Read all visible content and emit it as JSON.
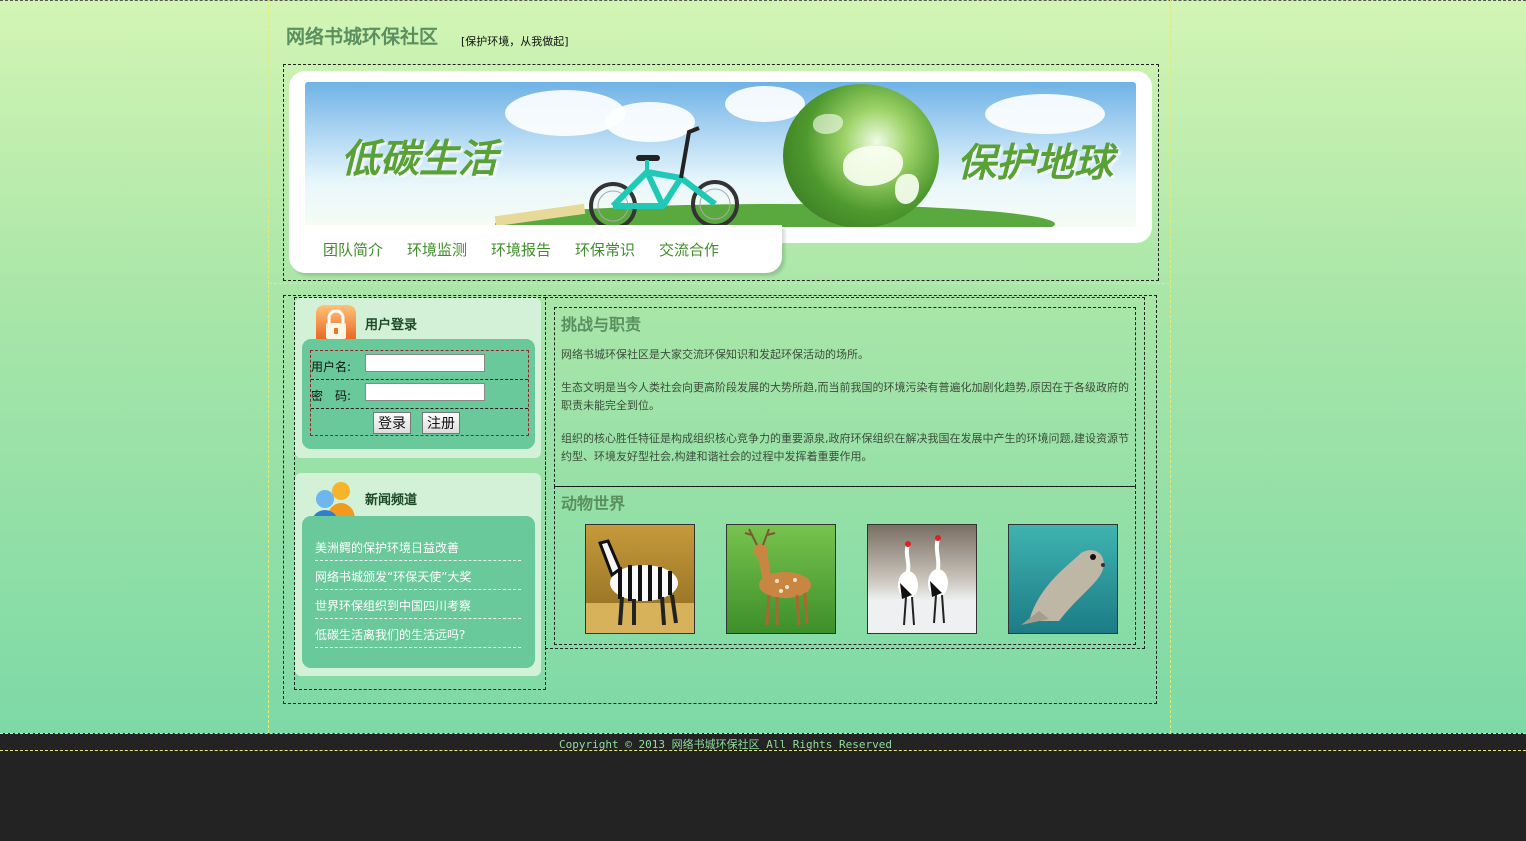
{
  "header": {
    "site_title": "网络书城环保社区",
    "slogan": "[保护环境，从我做起]"
  },
  "banner": {
    "left_text": "低碳生活",
    "right_text": "保护地球"
  },
  "nav": {
    "items": [
      {
        "label": "团队简介"
      },
      {
        "label": "环境监测"
      },
      {
        "label": "环境报告"
      },
      {
        "label": "环保常识"
      },
      {
        "label": "交流合作"
      }
    ]
  },
  "login": {
    "title": "用户登录",
    "username_label": "用户名:",
    "password_label": "密　码:",
    "username_value": "",
    "password_value": "",
    "login_button": "登录",
    "register_button": "注册"
  },
  "news": {
    "title": "新闻频道",
    "items": [
      {
        "text": "美洲鳄的保护环境日益改善"
      },
      {
        "text": "网络书城颁发“环保天使”大奖"
      },
      {
        "text": "世界环保组织到中国四川考察"
      },
      {
        "text": "低碳生活离我们的生活远吗?"
      }
    ]
  },
  "article": {
    "title": "挑战与职责",
    "paragraphs": [
      "网络书城环保社区是大家交流环保知识和发起环保活动的场所。",
      "生态文明是当今人类社会向更高阶段发展的大势所趋,而当前我国的环境污染有普遍化加剧化趋势,原因在于各级政府的职责未能完全到位。",
      "组织的核心胜任特征是构成组织核心竞争力的重要源泉,政府环保组织在解决我国在发展中产生的环境问题,建设资源节约型、环境友好型社会,构建和谐社会的过程中发挥着重要作用。"
    ]
  },
  "animals": {
    "title": "动物世界",
    "images": [
      {
        "name": "zebra-photo"
      },
      {
        "name": "deer-photo"
      },
      {
        "name": "cranes-photo"
      },
      {
        "name": "sea-lion-photo"
      }
    ]
  },
  "footer": {
    "copyright": "Copyright © 2013 网络书城环保社区 All Rights Reserved"
  },
  "icons": {
    "login": "lock-icon",
    "news": "users-icon"
  },
  "colors": {
    "title_green": "#5a8f5f",
    "nav_green": "#3f8e2a",
    "panel_green": "#6ac99a",
    "footer_bg": "#232323"
  }
}
